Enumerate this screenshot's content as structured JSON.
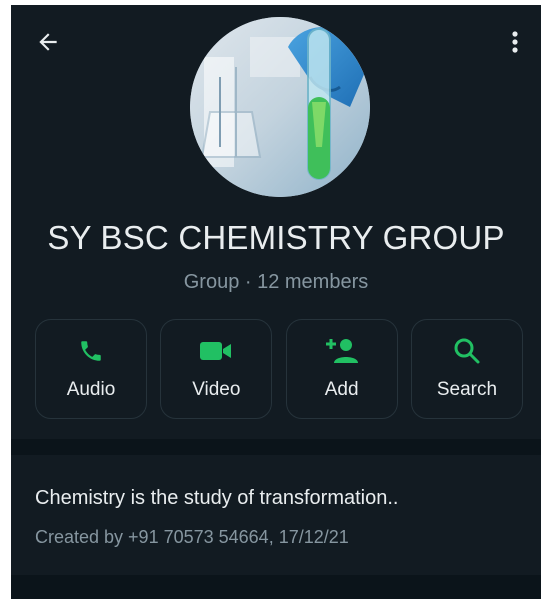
{
  "header": {
    "back_icon": "arrow-left-icon",
    "menu_icon": "more-vertical-icon"
  },
  "group": {
    "name": "SY BSC CHEMISTRY GROUP",
    "meta": "Group · 12 members"
  },
  "actions": [
    {
      "label": "Audio",
      "icon": "phone-icon"
    },
    {
      "label": "Video",
      "icon": "video-camera-icon"
    },
    {
      "label": "Add",
      "icon": "add-person-icon"
    },
    {
      "label": "Search",
      "icon": "search-icon"
    }
  ],
  "description": {
    "text": "Chemistry is the study of transformation..",
    "created": "Created by +91 70573 54664, 17/12/21"
  },
  "colors": {
    "accent": "#21c063",
    "background": "#121b22",
    "text_primary": "#e9edef",
    "text_secondary": "#8696a0"
  }
}
